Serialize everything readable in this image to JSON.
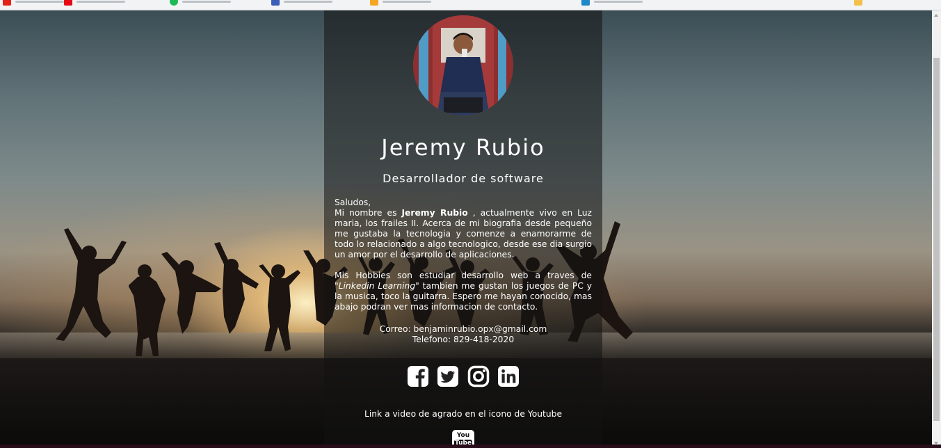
{
  "profile": {
    "name": "Jeremy Rubio",
    "title": "Desarrollador de software"
  },
  "bio": {
    "greeting": "Saludos,",
    "p1_before": "Mi nombre es ",
    "p1_name": "Jeremy Rubio",
    "p1_after": " , actualmente vivo en Luz maria, los frailes II. Acerca de mi biografia desde pequeño me gustaba la tecnologia y comenze a enamorarme de todo lo relacionado a algo tecnologico, desde ese dia surgio un amor por el desarrollo de aplicaciones.",
    "p2_before": "Mis Hobbies son estudiar desarrollo web a traves de \"",
    "p2_em": "Linkedin Learning",
    "p2_after": "\" tambien me gustan los juegos de PC y la musica, toco la guitarra. Espero me hayan conocido, mas abajo podran ver mas informacion de contacto."
  },
  "contact": {
    "email": "Correo: benjaminrubio.opx@gmail.com",
    "phone": "Telefono: 829-418-2020"
  },
  "socials": [
    "facebook-icon",
    "twitter-icon",
    "instagram-icon",
    "linkedin-icon"
  ],
  "youtube_note": "Link a video de agrado en el icono de Youtube",
  "youtube_icon": {
    "line1": "You",
    "line2": "Tube"
  },
  "colors": {
    "panel_overlay": "rgba(18,18,18,0.55)",
    "text": "#ffffff"
  }
}
